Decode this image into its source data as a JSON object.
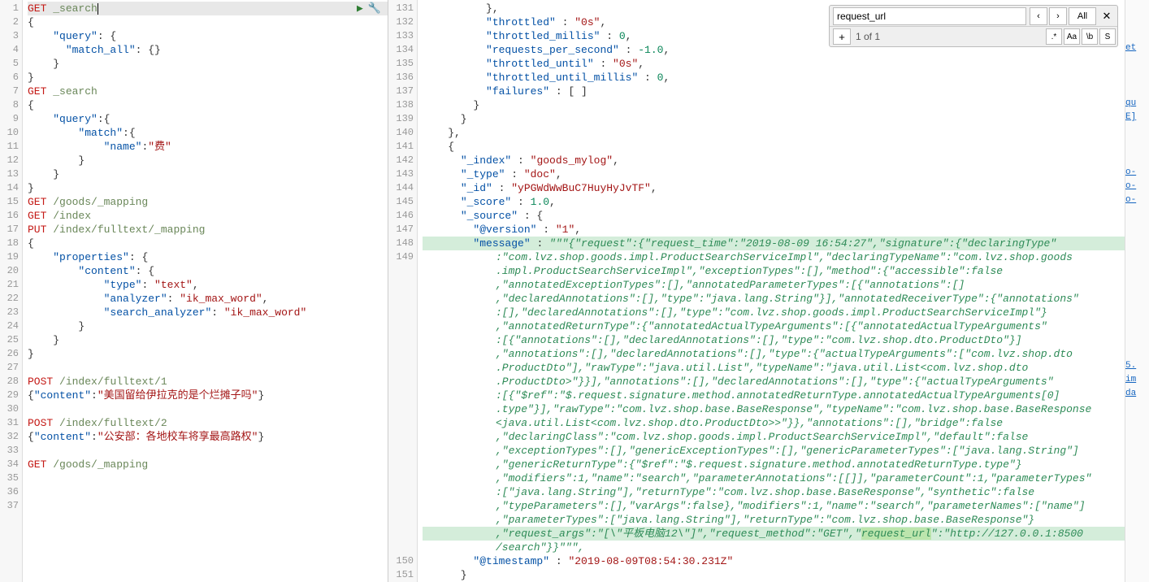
{
  "left": {
    "lines": [
      {
        "n": 1,
        "active": true,
        "parts": [
          {
            "t": "GET",
            "c": "method"
          },
          {
            "t": " "
          },
          {
            "t": "_search",
            "c": "path"
          }
        ],
        "cursor": true
      },
      {
        "n": 2,
        "parts": [
          {
            "t": "{",
            "c": "punct"
          }
        ]
      },
      {
        "n": 3,
        "parts": [
          {
            "t": "    "
          },
          {
            "t": "\"query\"",
            "c": "key"
          },
          {
            "t": ": {",
            "c": "punct"
          }
        ]
      },
      {
        "n": 4,
        "parts": [
          {
            "t": "      "
          },
          {
            "t": "\"match_all\"",
            "c": "key"
          },
          {
            "t": ": {}",
            "c": "punct"
          }
        ]
      },
      {
        "n": 5,
        "parts": [
          {
            "t": "    }",
            "c": "punct"
          }
        ]
      },
      {
        "n": 6,
        "parts": [
          {
            "t": "}",
            "c": "punct"
          }
        ]
      },
      {
        "n": 7,
        "parts": [
          {
            "t": "GET",
            "c": "method"
          },
          {
            "t": " "
          },
          {
            "t": "_search",
            "c": "path"
          }
        ]
      },
      {
        "n": 8,
        "parts": [
          {
            "t": "{",
            "c": "punct"
          }
        ]
      },
      {
        "n": 9,
        "parts": [
          {
            "t": "    "
          },
          {
            "t": "\"query\"",
            "c": "key"
          },
          {
            "t": ":{",
            "c": "punct"
          }
        ]
      },
      {
        "n": 10,
        "parts": [
          {
            "t": "        "
          },
          {
            "t": "\"match\"",
            "c": "key"
          },
          {
            "t": ":{",
            "c": "punct"
          }
        ]
      },
      {
        "n": 11,
        "parts": [
          {
            "t": "            "
          },
          {
            "t": "\"name\"",
            "c": "key"
          },
          {
            "t": ":",
            "c": "punct"
          },
          {
            "t": "\"费\"",
            "c": "string"
          }
        ]
      },
      {
        "n": 12,
        "parts": [
          {
            "t": "        }",
            "c": "punct"
          }
        ]
      },
      {
        "n": 13,
        "parts": [
          {
            "t": "    }",
            "c": "punct"
          }
        ]
      },
      {
        "n": 14,
        "parts": [
          {
            "t": "}",
            "c": "punct"
          }
        ]
      },
      {
        "n": 15,
        "parts": [
          {
            "t": "GET",
            "c": "method"
          },
          {
            "t": " "
          },
          {
            "t": "/goods/_mapping",
            "c": "path"
          }
        ]
      },
      {
        "n": 16,
        "parts": [
          {
            "t": "GET",
            "c": "method"
          },
          {
            "t": " "
          },
          {
            "t": "/index",
            "c": "path"
          }
        ]
      },
      {
        "n": 17,
        "parts": [
          {
            "t": "PUT",
            "c": "method"
          },
          {
            "t": " "
          },
          {
            "t": "/index/fulltext/_mapping",
            "c": "path"
          }
        ]
      },
      {
        "n": 18,
        "parts": [
          {
            "t": "{",
            "c": "punct"
          }
        ]
      },
      {
        "n": 19,
        "parts": [
          {
            "t": "    "
          },
          {
            "t": "\"properties\"",
            "c": "key"
          },
          {
            "t": ": {",
            "c": "punct"
          }
        ]
      },
      {
        "n": 20,
        "parts": [
          {
            "t": "        "
          },
          {
            "t": "\"content\"",
            "c": "key"
          },
          {
            "t": ": {",
            "c": "punct"
          }
        ]
      },
      {
        "n": 21,
        "parts": [
          {
            "t": "            "
          },
          {
            "t": "\"type\"",
            "c": "key"
          },
          {
            "t": ": ",
            "c": "punct"
          },
          {
            "t": "\"text\"",
            "c": "string"
          },
          {
            "t": ",",
            "c": "punct"
          }
        ]
      },
      {
        "n": 22,
        "parts": [
          {
            "t": "            "
          },
          {
            "t": "\"analyzer\"",
            "c": "key"
          },
          {
            "t": ": ",
            "c": "punct"
          },
          {
            "t": "\"ik_max_word\"",
            "c": "string"
          },
          {
            "t": ",",
            "c": "punct"
          }
        ]
      },
      {
        "n": 23,
        "parts": [
          {
            "t": "            "
          },
          {
            "t": "\"search_analyzer\"",
            "c": "key"
          },
          {
            "t": ": ",
            "c": "punct"
          },
          {
            "t": "\"ik_max_word\"",
            "c": "string"
          }
        ]
      },
      {
        "n": 24,
        "parts": [
          {
            "t": "        }",
            "c": "punct"
          }
        ]
      },
      {
        "n": 25,
        "parts": [
          {
            "t": "    }",
            "c": "punct"
          }
        ]
      },
      {
        "n": 26,
        "parts": [
          {
            "t": "}",
            "c": "punct"
          }
        ]
      },
      {
        "n": 27,
        "parts": []
      },
      {
        "n": 28,
        "parts": [
          {
            "t": "POST",
            "c": "method"
          },
          {
            "t": " "
          },
          {
            "t": "/index/fulltext/1",
            "c": "path"
          }
        ]
      },
      {
        "n": 29,
        "parts": [
          {
            "t": "{",
            "c": "punct"
          },
          {
            "t": "\"content\"",
            "c": "key"
          },
          {
            "t": ":",
            "c": "punct"
          },
          {
            "t": "\"美国留给伊拉克的是个烂摊子吗\"",
            "c": "string"
          },
          {
            "t": "}",
            "c": "punct"
          }
        ]
      },
      {
        "n": 30,
        "parts": []
      },
      {
        "n": 31,
        "parts": [
          {
            "t": "POST",
            "c": "method"
          },
          {
            "t": " "
          },
          {
            "t": "/index/fulltext/2",
            "c": "path"
          }
        ]
      },
      {
        "n": 32,
        "parts": [
          {
            "t": "{",
            "c": "punct"
          },
          {
            "t": "\"content\"",
            "c": "key"
          },
          {
            "t": ":",
            "c": "punct"
          },
          {
            "t": "\"公安部：各地校车将享最高路权\"",
            "c": "string"
          },
          {
            "t": "}",
            "c": "punct"
          }
        ]
      },
      {
        "n": 33,
        "parts": []
      },
      {
        "n": 34,
        "parts": [
          {
            "t": "GET",
            "c": "method"
          },
          {
            "t": " "
          },
          {
            "t": "/goods/_mapping",
            "c": "path"
          }
        ]
      },
      {
        "n": 35,
        "parts": []
      },
      {
        "n": 36,
        "parts": []
      },
      {
        "n": 37,
        "parts": []
      }
    ]
  },
  "right": {
    "lines": [
      {
        "n": 131,
        "parts": [
          {
            "t": "          },",
            "c": "punct"
          }
        ]
      },
      {
        "n": 132,
        "parts": [
          {
            "t": "          "
          },
          {
            "t": "\"throttled\"",
            "c": "key"
          },
          {
            "t": " : ",
            "c": "punct"
          },
          {
            "t": "\"0s\"",
            "c": "string"
          },
          {
            "t": ",",
            "c": "punct"
          }
        ]
      },
      {
        "n": 133,
        "parts": [
          {
            "t": "          "
          },
          {
            "t": "\"throttled_millis\"",
            "c": "key"
          },
          {
            "t": " : ",
            "c": "punct"
          },
          {
            "t": "0",
            "c": "number"
          },
          {
            "t": ",",
            "c": "punct"
          }
        ]
      },
      {
        "n": 134,
        "parts": [
          {
            "t": "          "
          },
          {
            "t": "\"requests_per_second\"",
            "c": "key"
          },
          {
            "t": " : ",
            "c": "punct"
          },
          {
            "t": "-1.0",
            "c": "number"
          },
          {
            "t": ",",
            "c": "punct"
          }
        ]
      },
      {
        "n": 135,
        "parts": [
          {
            "t": "          "
          },
          {
            "t": "\"throttled_until\"",
            "c": "key"
          },
          {
            "t": " : ",
            "c": "punct"
          },
          {
            "t": "\"0s\"",
            "c": "string"
          },
          {
            "t": ",",
            "c": "punct"
          }
        ]
      },
      {
        "n": 136,
        "parts": [
          {
            "t": "          "
          },
          {
            "t": "\"throttled_until_millis\"",
            "c": "key"
          },
          {
            "t": " : ",
            "c": "punct"
          },
          {
            "t": "0",
            "c": "number"
          },
          {
            "t": ",",
            "c": "punct"
          }
        ]
      },
      {
        "n": 137,
        "parts": [
          {
            "t": "          "
          },
          {
            "t": "\"failures\"",
            "c": "key"
          },
          {
            "t": " : [ ]",
            "c": "punct"
          }
        ]
      },
      {
        "n": 138,
        "parts": [
          {
            "t": "        }",
            "c": "punct"
          }
        ]
      },
      {
        "n": 139,
        "parts": [
          {
            "t": "      }",
            "c": "punct"
          }
        ]
      },
      {
        "n": 140,
        "parts": [
          {
            "t": "    },",
            "c": "punct"
          }
        ]
      },
      {
        "n": 141,
        "parts": [
          {
            "t": "    {",
            "c": "punct"
          }
        ]
      },
      {
        "n": 142,
        "parts": [
          {
            "t": "      "
          },
          {
            "t": "\"_index\"",
            "c": "key"
          },
          {
            "t": " : ",
            "c": "punct"
          },
          {
            "t": "\"goods_mylog\"",
            "c": "string"
          },
          {
            "t": ",",
            "c": "punct"
          }
        ]
      },
      {
        "n": 143,
        "parts": [
          {
            "t": "      "
          },
          {
            "t": "\"_type\"",
            "c": "key"
          },
          {
            "t": " : ",
            "c": "punct"
          },
          {
            "t": "\"doc\"",
            "c": "string"
          },
          {
            "t": ",",
            "c": "punct"
          }
        ]
      },
      {
        "n": 144,
        "parts": [
          {
            "t": "      "
          },
          {
            "t": "\"_id\"",
            "c": "key"
          },
          {
            "t": " : ",
            "c": "punct"
          },
          {
            "t": "\"yPGWdWwBuC7HuyHyJvTF\"",
            "c": "string"
          },
          {
            "t": ",",
            "c": "punct"
          }
        ]
      },
      {
        "n": 145,
        "parts": [
          {
            "t": "      "
          },
          {
            "t": "\"_score\"",
            "c": "key"
          },
          {
            "t": " : ",
            "c": "punct"
          },
          {
            "t": "1.0",
            "c": "number"
          },
          {
            "t": ",",
            "c": "punct"
          }
        ]
      },
      {
        "n": 146,
        "parts": [
          {
            "t": "      "
          },
          {
            "t": "\"_source\"",
            "c": "key"
          },
          {
            "t": " : {",
            "c": "punct"
          }
        ]
      },
      {
        "n": 147,
        "parts": [
          {
            "t": "        "
          },
          {
            "t": "\"@version\"",
            "c": "key"
          },
          {
            "t": " : ",
            "c": "punct"
          },
          {
            "t": "\"1\"",
            "c": "string"
          },
          {
            "t": ",",
            "c": "punct"
          }
        ]
      },
      {
        "n": 148,
        "hl": true,
        "parts": [
          {
            "t": "        "
          },
          {
            "t": "\"message\"",
            "c": "key"
          },
          {
            "t": " : ",
            "c": "punct"
          },
          {
            "t": "\"\"\"{\"request\":{\"request_time\":\"2019-08-09 16:54:27\",\"signature\":{\"declaringType\"",
            "c": "italic-str"
          }
        ]
      }
    ],
    "message_wrap": [
      ":\"com.lvz.shop.goods.impl.ProductSearchServiceImpl\",\"declaringTypeName\":\"com.lvz.shop.goods",
      ".impl.ProductSearchServiceImpl\",\"exceptionTypes\":[],\"method\":{\"accessible\":false",
      ",\"annotatedExceptionTypes\":[],\"annotatedParameterTypes\":[{\"annotations\":[]",
      ",\"declaredAnnotations\":[],\"type\":\"java.lang.String\"}],\"annotatedReceiverType\":{\"annotations\"",
      ":[],\"declaredAnnotations\":[],\"type\":\"com.lvz.shop.goods.impl.ProductSearchServiceImpl\"}",
      ",\"annotatedReturnType\":{\"annotatedActualTypeArguments\":[{\"annotatedActualTypeArguments\"",
      ":[{\"annotations\":[],\"declaredAnnotations\":[],\"type\":\"com.lvz.shop.dto.ProductDto\"}]",
      ",\"annotations\":[],\"declaredAnnotations\":[],\"type\":{\"actualTypeArguments\":[\"com.lvz.shop.dto",
      ".ProductDto\"],\"rawType\":\"java.util.List\",\"typeName\":\"java.util.List<com.lvz.shop.dto",
      ".ProductDto>\"}}],\"annotations\":[],\"declaredAnnotations\":[],\"type\":{\"actualTypeArguments\"",
      ":[{\"$ref\":\"$.request.signature.method.annotatedReturnType.annotatedActualTypeArguments[0]",
      ".type\"}],\"rawType\":\"com.lvz.shop.base.BaseResponse\",\"typeName\":\"com.lvz.shop.base.BaseResponse",
      "<java.util.List<com.lvz.shop.dto.ProductDto>>\"}},\"annotations\":[],\"bridge\":false",
      ",\"declaringClass\":\"com.lvz.shop.goods.impl.ProductSearchServiceImpl\",\"default\":false",
      ",\"exceptionTypes\":[],\"genericExceptionTypes\":[],\"genericParameterTypes\":[\"java.lang.String\"]",
      ",\"genericReturnType\":{\"$ref\":\"$.request.signature.method.annotatedReturnType.type\"}",
      ",\"modifiers\":1,\"name\":\"search\",\"parameterAnnotations\":[[]],\"parameterCount\":1,\"parameterTypes\"",
      ":[\"java.lang.String\"],\"returnType\":\"com.lvz.shop.base.BaseResponse\",\"synthetic\":false",
      ",\"typeParameters\":[],\"varArgs\":false},\"modifiers\":1,\"name\":\"search\",\"parameterNames\":[\"name\"]",
      ",\"parameterTypes\":[\"java.lang.String\"],\"returnType\":\"com.lvz.shop.base.BaseResponse\"}"
    ],
    "message_last": {
      "pre": ",\"request_args\":\"[\\\"平板电脑12\\\"]\",\"request_method\":\"GET\",\"",
      "match": "request_url",
      "post": "\":\"http://127.0.0.1:8500"
    },
    "message_tail": "/search\"}}\"\"\",",
    "after_lines": [
      {
        "n": 150,
        "parts": [
          {
            "t": "        "
          },
          {
            "t": "\"@timestamp\"",
            "c": "key"
          },
          {
            "t": " : ",
            "c": "punct"
          },
          {
            "t": "\"2019-08-09T08:54:30.231Z\"",
            "c": "string"
          }
        ]
      },
      {
        "n": 151,
        "parts": [
          {
            "t": "      }",
            "c": "punct"
          }
        ]
      }
    ]
  },
  "find": {
    "value": "request_url",
    "prev": "‹",
    "next": "›",
    "all": "All",
    "close": "✕",
    "plus": "+",
    "count": "1 of 1",
    "regex": ".*",
    "case": "Aa",
    "word": "\\b",
    "sel": "S"
  },
  "controls": {
    "play": "▶",
    "wrench": "🔧"
  },
  "extra": [
    "",
    "",
    "",
    "et",
    "",
    "",
    "",
    "qu",
    "E]",
    "",
    "",
    "",
    "o-",
    "o-",
    "o-",
    "",
    "",
    "",
    "",
    "",
    "",
    "",
    "",
    "",
    "",
    "",
    "5.",
    "im",
    "da",
    "",
    "",
    "",
    "",
    "",
    "",
    "",
    "",
    "",
    "",
    "",
    "",
    ""
  ]
}
